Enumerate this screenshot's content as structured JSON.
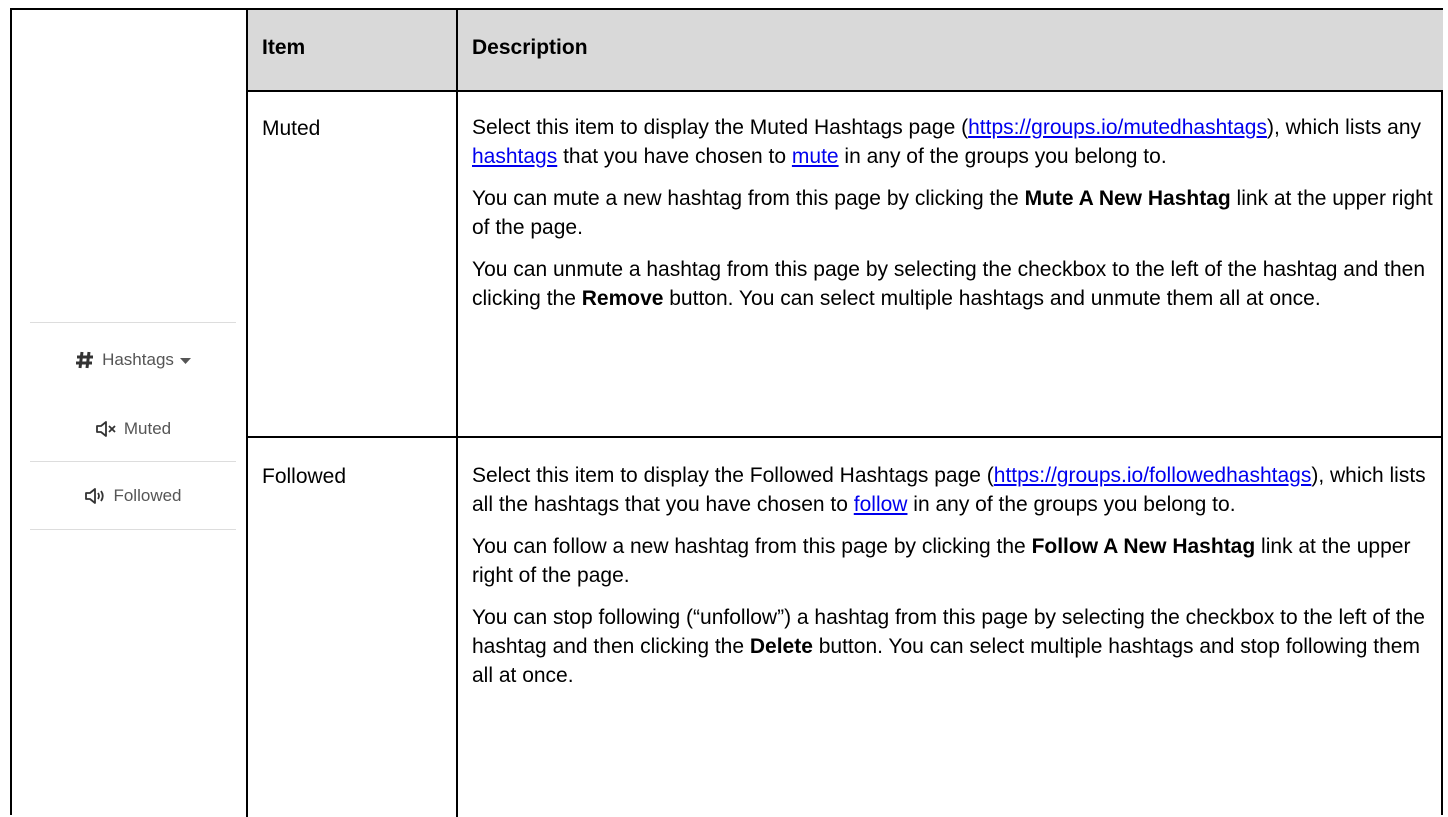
{
  "table": {
    "headers": {
      "item": "Item",
      "description": "Description"
    },
    "rows": [
      {
        "item": "Muted",
        "paragraphs": [
          [
            {
              "t": "Select this item to display the Muted Hashtags page ("
            },
            {
              "t": "https://groups.io/mutedhashtags",
              "link": true
            },
            {
              "t": "), which lists any "
            },
            {
              "t": "hashtags",
              "link": true
            },
            {
              "t": " that you have chosen to "
            },
            {
              "t": "mute",
              "link": true
            },
            {
              "t": " in any of the groups you belong to."
            }
          ],
          [
            {
              "t": "You can mute a new hashtag from this page by clicking the "
            },
            {
              "t": "Mute A New Hashtag",
              "bold": true
            },
            {
              "t": " link at the upper right of the page."
            }
          ],
          [
            {
              "t": "You can unmute a hashtag from this page by selecting the checkbox to the left of the hashtag and then clicking the "
            },
            {
              "t": "Remove",
              "bold": true
            },
            {
              "t": " button. You can select multiple hashtags and unmute them all at once."
            }
          ]
        ]
      },
      {
        "item": "Followed",
        "paragraphs": [
          [
            {
              "t": "Select this item to display the Followed Hashtags page ("
            },
            {
              "t": "https://groups.io/followedhashtags",
              "link": true
            },
            {
              "t": "), which lists all the hashtags that you have chosen to "
            },
            {
              "t": "follow",
              "link": true
            },
            {
              "t": " in any of the groups you belong to."
            }
          ],
          [
            {
              "t": "You can follow a new hashtag from this page by clicking the "
            },
            {
              "t": "Follow A New Hashtag",
              "bold": true
            },
            {
              "t": " link at the upper right of the page."
            }
          ],
          [
            {
              "t": "You can stop following (“unfollow”) a hashtag from this page by selecting the checkbox to the left of the hashtag and then clicking the "
            },
            {
              "t": "Delete",
              "bold": true
            },
            {
              "t": " button. You can select multiple hashtags and stop following them all at once."
            }
          ]
        ]
      }
    ]
  },
  "menu": {
    "hashtags_label": "Hashtags",
    "muted_label": "Muted",
    "followed_label": "Followed",
    "hashtags_icon": "hash-icon",
    "dropdown_icon": "caret-down-icon",
    "muted_icon": "speaker-muted-icon",
    "followed_icon": "speaker-on-icon"
  },
  "colors": {
    "header_bg": "#d9d9d9",
    "link": "#0000ee",
    "menu_text": "#555555"
  }
}
